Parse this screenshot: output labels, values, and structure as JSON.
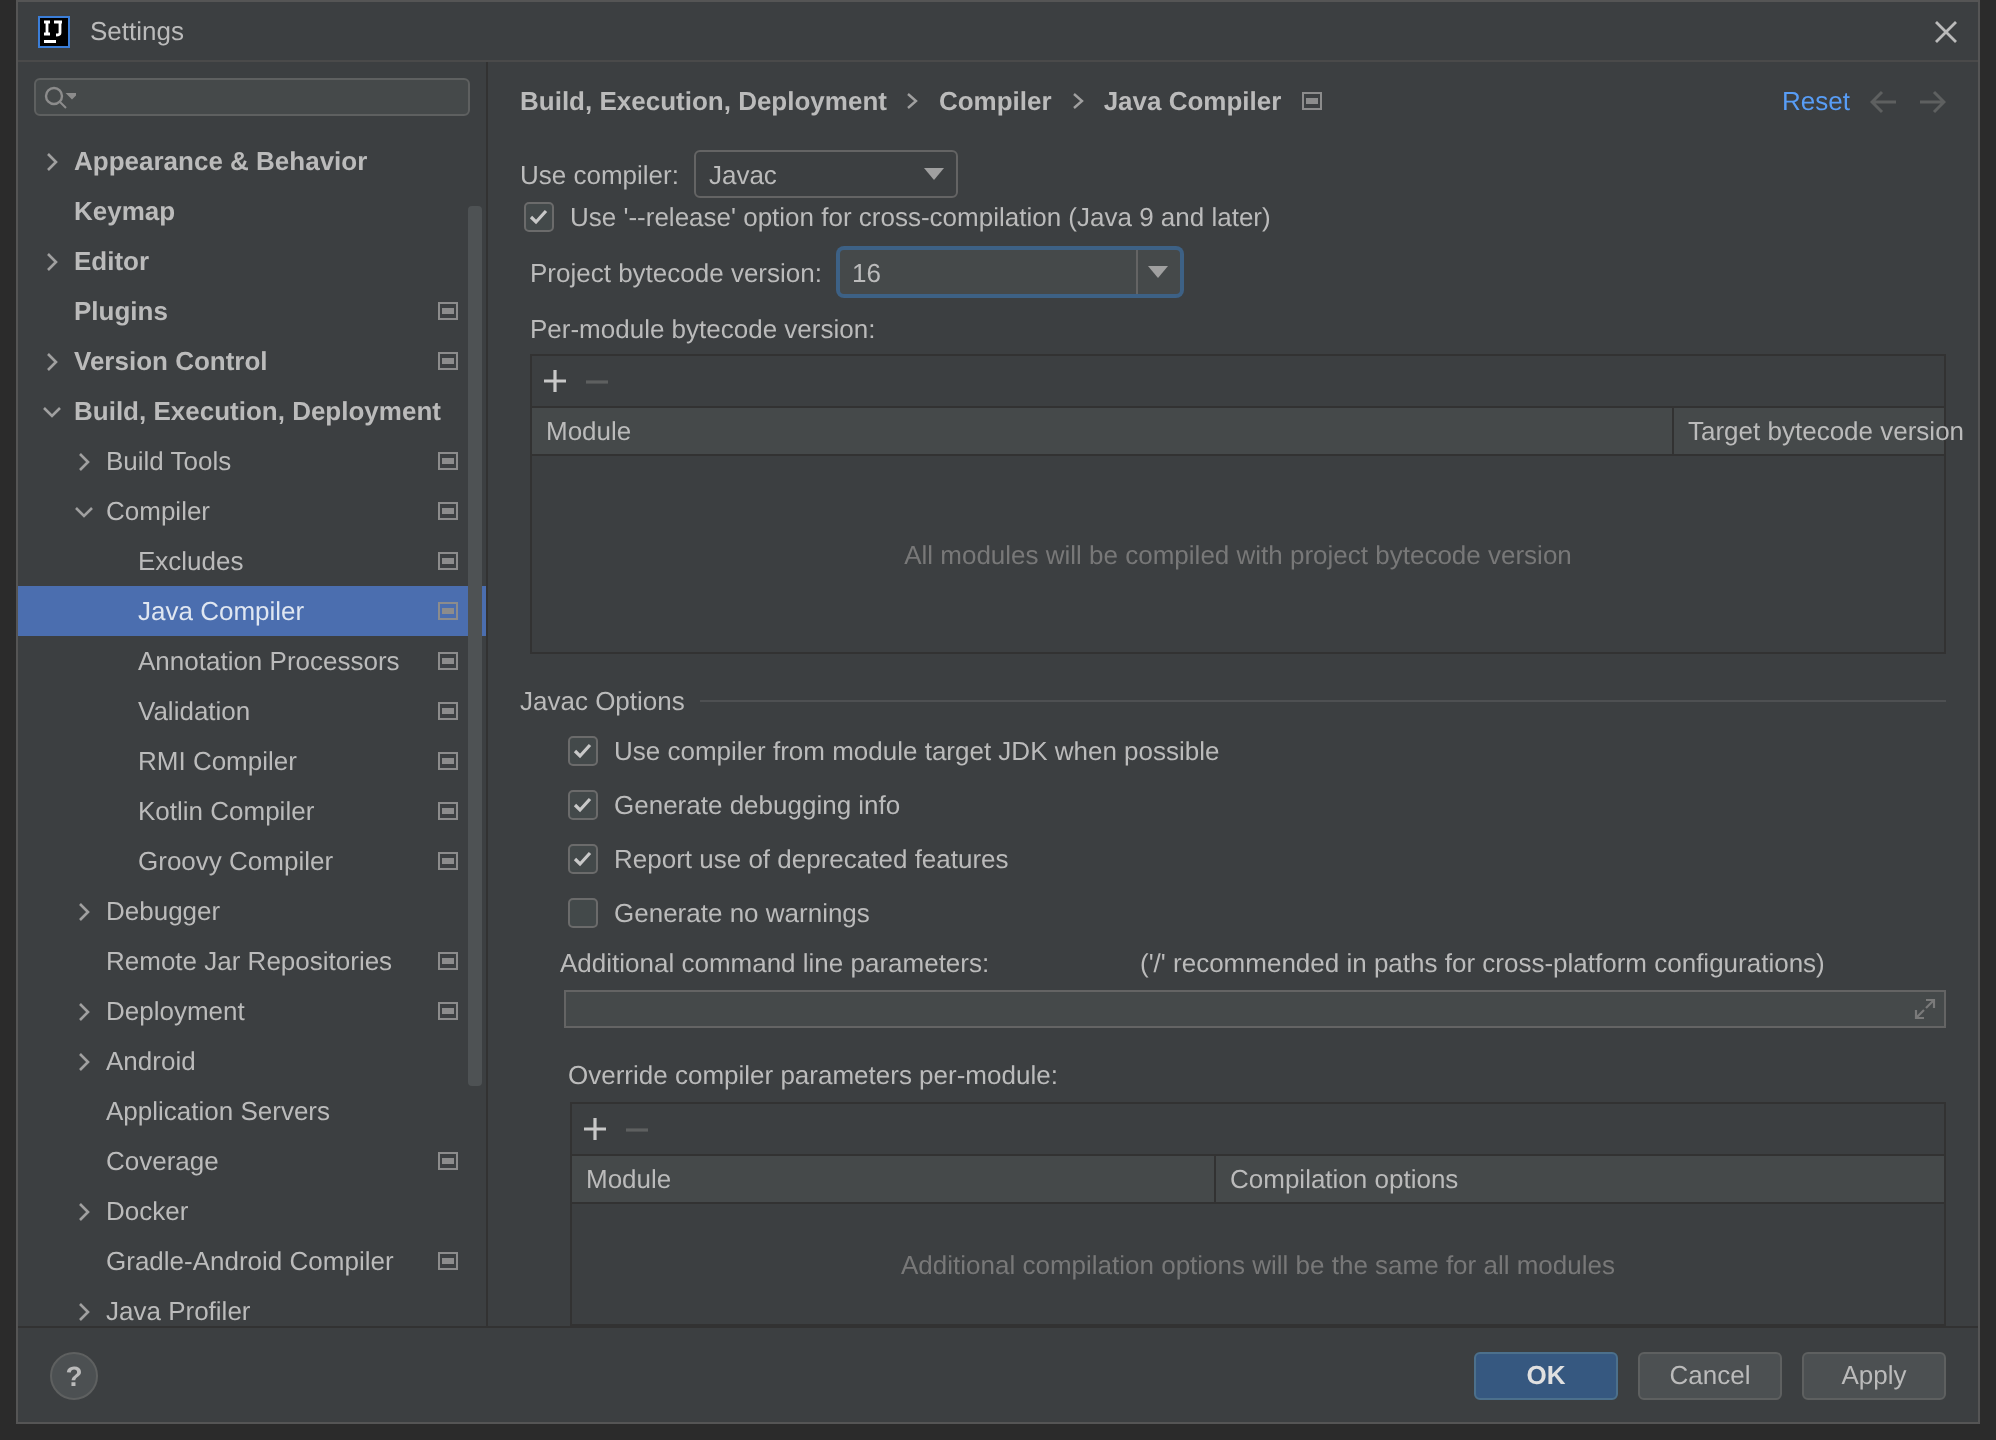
{
  "window": {
    "title": "Settings"
  },
  "help": "?",
  "sidebar": {
    "items": [
      {
        "label": "Appearance & Behavior",
        "expanded": false,
        "selected": false
      },
      {
        "label": "Keymap",
        "selected": false
      },
      {
        "label": "Editor",
        "expanded": false,
        "selected": false
      },
      {
        "label": "Plugins",
        "project_icon": true,
        "selected": false
      },
      {
        "label": "Version Control",
        "expanded": false,
        "project_icon": true,
        "selected": false
      },
      {
        "label": "Build, Execution, Deployment",
        "expanded": true,
        "selected": false,
        "children": [
          {
            "label": "Build Tools",
            "expanded": false,
            "project_icon": true,
            "selected": false
          },
          {
            "label": "Compiler",
            "expanded": true,
            "project_icon": true,
            "selected": false,
            "children": [
              {
                "label": "Excludes",
                "project_icon": true,
                "selected": false
              },
              {
                "label": "Java Compiler",
                "project_icon": true,
                "selected": true
              },
              {
                "label": "Annotation Processors",
                "project_icon": true,
                "selected": false
              },
              {
                "label": "Validation",
                "project_icon": true,
                "selected": false
              },
              {
                "label": "RMI Compiler",
                "project_icon": true,
                "selected": false
              },
              {
                "label": "Kotlin Compiler",
                "project_icon": true,
                "selected": false
              },
              {
                "label": "Groovy Compiler",
                "project_icon": true,
                "selected": false
              }
            ]
          },
          {
            "label": "Debugger",
            "expanded": false,
            "selected": false
          },
          {
            "label": "Remote Jar Repositories",
            "project_icon": true,
            "selected": false
          },
          {
            "label": "Deployment",
            "expanded": false,
            "project_icon": true,
            "selected": false
          },
          {
            "label": "Android",
            "expanded": false,
            "selected": false
          },
          {
            "label": "Application Servers",
            "selected": false
          },
          {
            "label": "Coverage",
            "project_icon": true,
            "selected": false
          },
          {
            "label": "Docker",
            "expanded": false,
            "selected": false
          },
          {
            "label": "Gradle-Android Compiler",
            "project_icon": true,
            "selected": false
          },
          {
            "label": "Java Profiler",
            "expanded": false,
            "selected": false
          }
        ]
      }
    ]
  },
  "breadcrumb": [
    "Build, Execution, Deployment",
    "Compiler",
    "Java Compiler"
  ],
  "reset": "Reset",
  "use_compiler": {
    "label": "Use compiler:",
    "value": "Javac"
  },
  "release_option": {
    "label": "Use '--release' option for cross-compilation (Java 9 and later)",
    "checked": true
  },
  "bytecode_version": {
    "label": "Project bytecode version:",
    "value": "16"
  },
  "per_module": {
    "label": "Per-module bytecode version:",
    "columns": [
      "Module",
      "Target bytecode version"
    ],
    "empty_text": "All modules will be compiled with project bytecode version"
  },
  "javac_options": {
    "title": "Javac Options",
    "checkboxes": [
      {
        "label": "Use compiler from module target JDK when possible",
        "checked": true
      },
      {
        "label": "Generate debugging info",
        "checked": true
      },
      {
        "label": "Report use of deprecated features",
        "checked": true
      },
      {
        "label": "Generate no warnings",
        "checked": false
      }
    ],
    "params_label": "Additional command line parameters:",
    "params_hint": "('/' recommended in paths for cross-platform configurations)"
  },
  "override": {
    "label": "Override compiler parameters per-module:",
    "columns": [
      "Module",
      "Compilation options"
    ],
    "empty_text": "Additional compilation options will be the same for all modules"
  },
  "buttons": [
    {
      "label": "OK",
      "kind": "primary"
    },
    {
      "label": "Cancel",
      "kind": "normal"
    },
    {
      "label": "Apply",
      "kind": "normal"
    }
  ]
}
